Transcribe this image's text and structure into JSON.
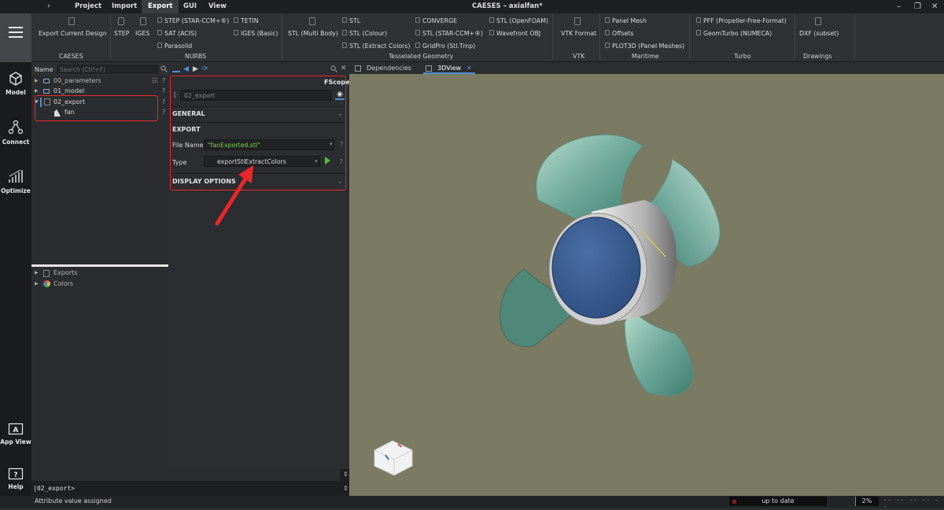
{
  "window": {
    "title": "CAESES – axialfan*",
    "menu": [
      "Project",
      "Import",
      "Export",
      "GUI",
      "View"
    ],
    "active_menu": "Export",
    "expand_glyph": "›"
  },
  "rail": {
    "items": [
      {
        "label": "Model",
        "icon": "cube-icon"
      },
      {
        "label": "Connect",
        "icon": "connect-icon"
      },
      {
        "label": "Optimize",
        "icon": "chart-icon"
      },
      {
        "label": "App View",
        "icon": "app-view-icon"
      },
      {
        "label": "Help",
        "icon": "help-icon"
      }
    ],
    "app_view_glyph": "A",
    "help_glyph": "?"
  },
  "ribbon": {
    "groups": {
      "caeses": "CAESES",
      "nurbs": "NURBS",
      "tess": "Tesselated Geometry",
      "vtk": "VTK",
      "maritime": "Maritime",
      "turbo": "Turbo",
      "drawings": "Drawings"
    },
    "buttons": {
      "export_current": "Export Current Design",
      "step": "STEP",
      "iges": "IGES",
      "step_star": "STEP (STAR-CCM+®)",
      "sat": "SAT (ACIS)",
      "parasolid": "Parasolid",
      "tetin": "TETIN",
      "iges_basic": "IGES (Basic)",
      "stl_multi": "STL (Multi Body)",
      "stl": "STL",
      "stl_colour": "STL (Colour)",
      "stl_extract": "STL (Extract Colors)",
      "converge": "CONVERGE",
      "stl_star": "STL (STAR-CCM+®)",
      "gridpro": "GridPro (Stl.Tmp)",
      "stl_openfoam": "STL (OpenFOAM)",
      "wavefront": "Wavefront OBJ",
      "vtk_format": "VTK Format",
      "panel_mesh": "Panel Mesh",
      "offsets": "Offsets",
      "plot3d": "PLOT3D (Panel Meshes)",
      "pff": "PFF (Propeller-Free-Format)",
      "geomturbo": "GeomTurbo (NUMECA)",
      "dxf": "DXF (subset)"
    }
  },
  "tree": {
    "header": "Name",
    "search_placeholder": "Search (Ctrl+F)",
    "items": [
      {
        "label": "00_parameters"
      },
      {
        "label": "01_model"
      },
      {
        "label": "02_export"
      },
      {
        "label": "fan"
      }
    ],
    "lower_items": [
      {
        "label": "Exports"
      },
      {
        "label": "Colors"
      }
    ],
    "help_glyph": "?"
  },
  "props": {
    "scope_label": "FScope",
    "object_name": "02_export",
    "sections": {
      "general": "GENERAL",
      "export": "EXPORT",
      "display": "DISPLAY OPTIONS"
    },
    "file_name_label": "File Name",
    "file_name_value": "\"fanExported.stl\"",
    "type_label": "Type",
    "type_value": "exportStlExtractColors"
  },
  "view": {
    "tabs": [
      {
        "label": "Dependencies"
      },
      {
        "label": "3DView"
      }
    ],
    "active_tab": "3DView"
  },
  "command": {
    "prompt": "|02_export>"
  },
  "status": {
    "message": "Attribute value assigned",
    "state": "up to date",
    "progress_label": "2%",
    "progress": 0.02
  },
  "colors": {
    "background_view": "#7b7a62",
    "accent_red": "#e8272a",
    "blade": "#5f9c8c",
    "hub_cap": "#3c5f92"
  }
}
